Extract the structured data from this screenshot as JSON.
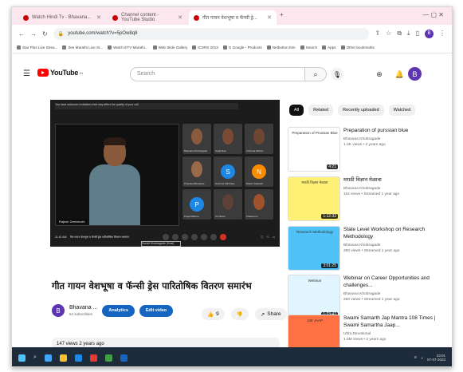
{
  "browser": {
    "tabs": [
      {
        "label": "Watch Hindi Tv - Bhavana..."
      },
      {
        "label": "Channel content - YouTube Studio"
      },
      {
        "label": "गीत गायन वेशभूषा व फॅन्सी ड्रे..."
      }
    ],
    "url": "youtube.com/watch?v=5pOw8q8",
    "profile_letter": "B"
  },
  "bookmarks": [
    "Star Plus Live Strea...",
    "Zee Marathi Live St...",
    "Watch ETV Marathi...",
    "Web Slide Gallery",
    "ICSRS 2013",
    "G Google - Products",
    "Netbutton.htm",
    "Search",
    "Apps",
    "Other bookmarks"
  ],
  "youtube": {
    "logo_text": "YouTube",
    "logo_sup": "IN",
    "search_placeholder": "Search",
    "avatar_letter": "B"
  },
  "player": {
    "top_text": "You have unknown invitations that may affect the quality of your call",
    "main_name": "Rajesh Deshmukh",
    "tiles": [
      {
        "name": "Bhavana Khobragade",
        "kind": "face",
        "color": "#8a5a3c"
      },
      {
        "name": "Anjali Rao",
        "kind": "face",
        "color": "#7a4a34"
      },
      {
        "name": "Archana Mishra",
        "kind": "face",
        "color": "#6e4632"
      },
      {
        "name": "Priyanka Bhandare",
        "kind": "face",
        "color": "#9a6a4a"
      },
      {
        "name": "Sushma Shirbhate",
        "kind": "letter",
        "letter": "S",
        "color": "#1e88e5"
      },
      {
        "name": "Nilesh Gaikwad",
        "kind": "letter",
        "letter": "N",
        "color": "#fb8c00"
      },
      {
        "name": "Pooja Mahure",
        "kind": "letter",
        "letter": "P",
        "color": "#1e88e5"
      },
      {
        "name": "10 others",
        "kind": "face",
        "color": "#5d4037"
      },
      {
        "name": "Classroom",
        "kind": "face",
        "color": "#a0522d"
      }
    ],
    "highlight_label": "Sonali Khobragade (Host)",
    "meeting_time": "11:41 AM",
    "meeting_title": "गीत गायन वेशभूषा व फॅन्सी ड्रेस पारितोषिक वितरण समारंभ"
  },
  "video": {
    "title": "गीत गायन वेशभूषा व फॅन्सी ड्रेस पारितोषिक वितरण समारंभ",
    "channel_letter": "B",
    "channel_name": "Bhavana ...",
    "subscribers": "54 subscribers",
    "analytics_label": "Analytics",
    "edit_label": "Edit video",
    "likes": "9",
    "share_label": "Share",
    "more_label": "...",
    "stats": "147 views  2 years ago"
  },
  "sidebar": {
    "chips": [
      "All",
      "Related",
      "Recently uploaded",
      "Watched"
    ],
    "items": [
      {
        "title": "Preparation of purssian blue",
        "channel": "Bhavana Khobragade",
        "meta": "1.3K views • 2 years ago",
        "duration": "4:21",
        "thumb_bg": "#ffffff",
        "thumb_text": "Preparation of Prussian Blue"
      },
      {
        "title": "मराठी विज्ञान मेळावा",
        "channel": "Bhavana Khobragade",
        "meta": "116 views • Streamed 1 year ago",
        "duration": "1:12:33",
        "thumb_bg": "#fff176",
        "thumb_text": "मराठी विज्ञान मेळावा"
      },
      {
        "title": "State Level Workshop on Research Methodology",
        "channel": "Bhavana Khobragade",
        "meta": "290 views • Streamed 1 year ago",
        "duration": "3:01:25",
        "thumb_bg": "#4fc3f7",
        "thumb_text": "Research Methodology"
      },
      {
        "title": "Webinar on Career Opportunities and challenges...",
        "channel": "Bhavana Khobragade",
        "meta": "260 views • Streamed 1 year ago",
        "duration": "1:23:47",
        "thumb_bg": "#e1f5fe",
        "thumb_text": "Webinar"
      },
      {
        "title": "Swami Samarth Jap Mantra 108 Times | Swami Samartha Jaap...",
        "channel": "Ultra Devotional",
        "meta": "1.5M views • 2 years ago",
        "duration": "",
        "thumb_bg": "#ff7043",
        "thumb_text": "108 JAAP"
      }
    ]
  },
  "taskbar": {
    "clock": "23:01",
    "date": "07-07-2023"
  }
}
